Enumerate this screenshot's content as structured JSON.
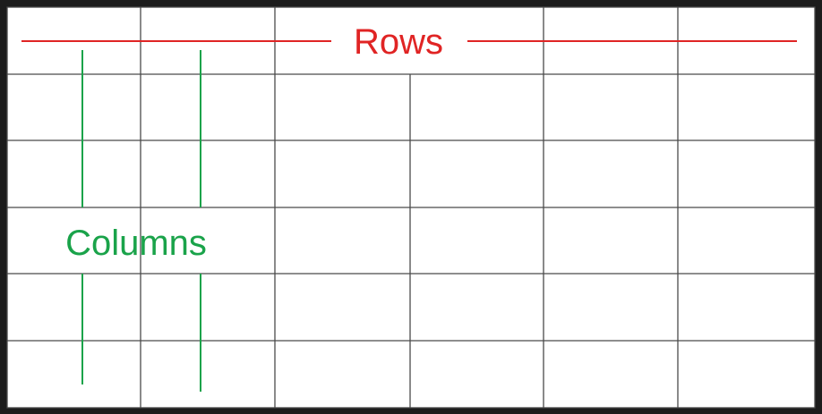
{
  "diagram": {
    "rows_label": "Rows",
    "columns_label": "Columns",
    "grid": {
      "row_count": 6,
      "column_count": 6
    },
    "colors": {
      "rows_accent": "#e02424",
      "columns_accent": "#1aa34a",
      "grid_line": "#4a4a4a",
      "background": "#ffffff",
      "outer_frame": "#1c1c1c"
    }
  }
}
